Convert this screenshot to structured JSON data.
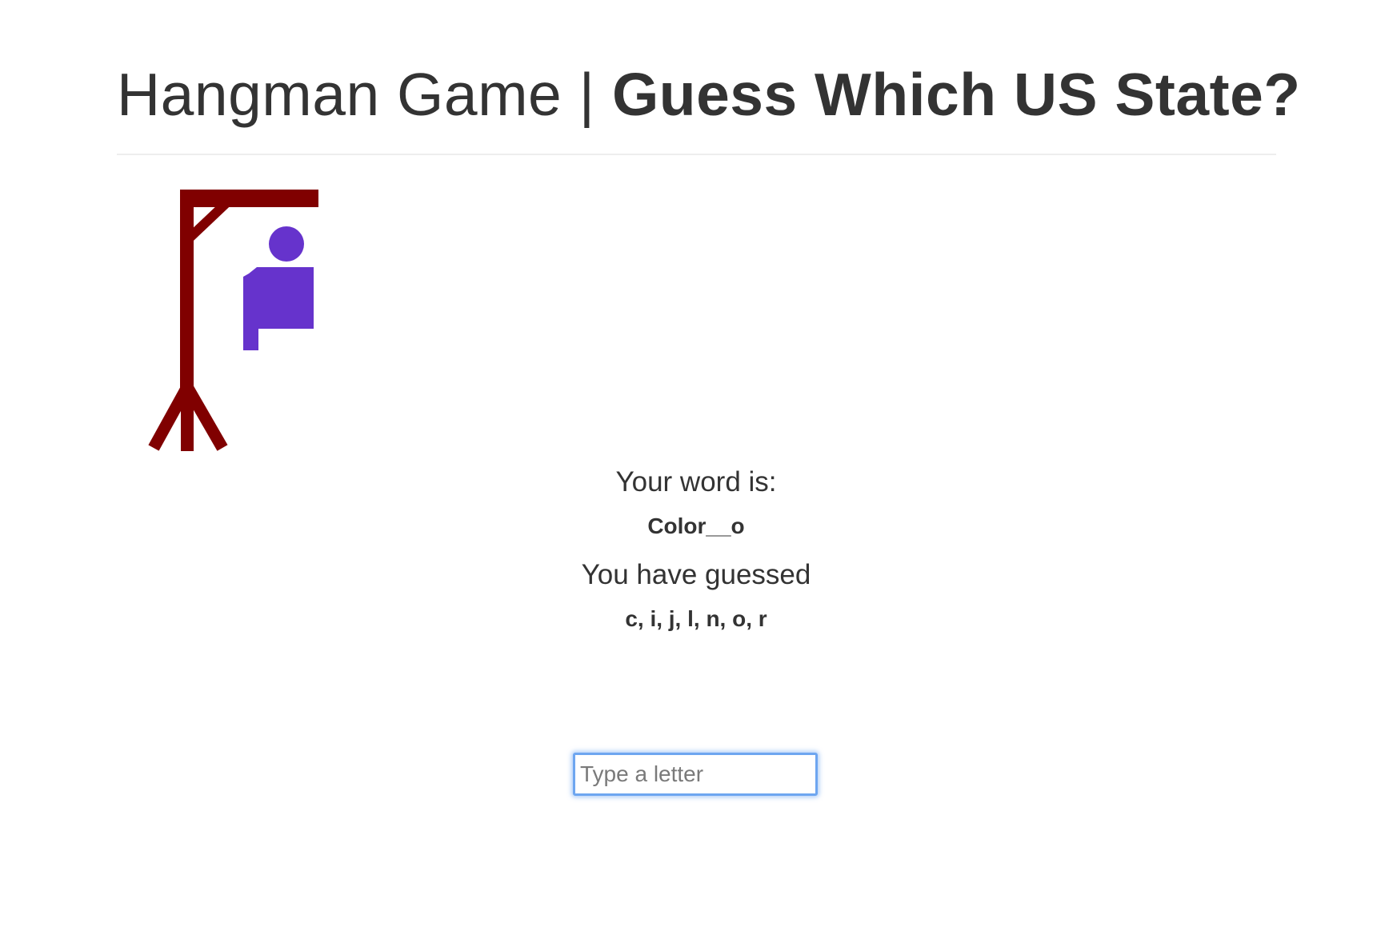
{
  "header": {
    "title_regular": "Hangman Game | ",
    "title_bold": "Guess Which US State?"
  },
  "colors": {
    "gallows": "#800000",
    "figure": "#6633cc",
    "input_focus_ring": "#6ea6f0"
  },
  "hangman": {
    "parts_shown": [
      "gallows",
      "head",
      "body",
      "left-arm"
    ]
  },
  "game": {
    "word_label": "Your word is:",
    "word_value": "Color__o",
    "guessed_label": "You have guessed",
    "guessed_value": "c, i, j, l, n, o, r"
  },
  "input": {
    "placeholder": "Type a letter",
    "value": ""
  }
}
